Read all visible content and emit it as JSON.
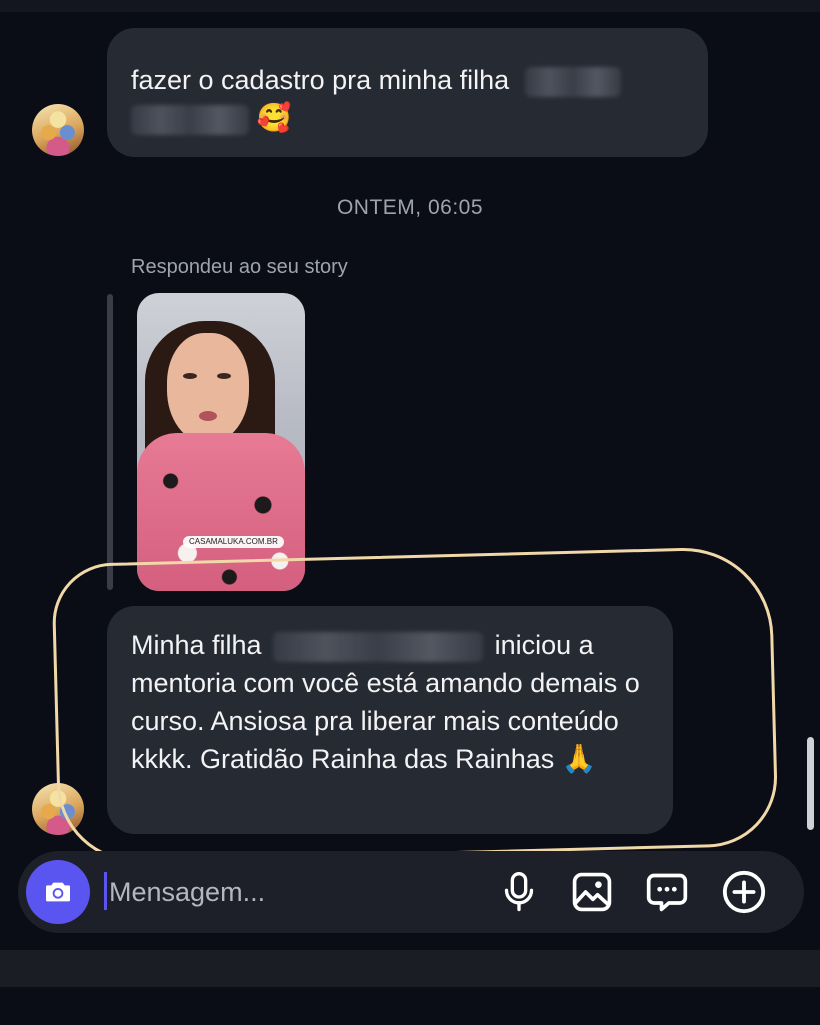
{
  "messages": {
    "first": {
      "text": "fazer o cadastro pra minha filha",
      "emoji": "🥰"
    },
    "timestamp": "ONTEM, 06:05",
    "story_reply": {
      "label": "Respondeu ao seu story",
      "story_tag": "CASAMALUKA.COM.BR"
    },
    "second": {
      "part1": "Minha filha",
      "part2": "iniciou a mentoria com você está amando demais o curso. Ansiosa pra liberar mais conteúdo kkkk. Gratidão Rainha das Rainhas",
      "emoji": "🙏"
    }
  },
  "composer": {
    "placeholder": "Mensagem..."
  },
  "icons": {
    "camera": "camera-icon",
    "mic": "microphone-icon",
    "gallery": "image-icon",
    "sticker": "chat-bubble-icon",
    "add": "plus-circle-icon"
  },
  "colors": {
    "background": "#0b0d16",
    "bubble": "#262a33",
    "accent": "#5a55f0",
    "highlight": "#f0d8a8"
  }
}
